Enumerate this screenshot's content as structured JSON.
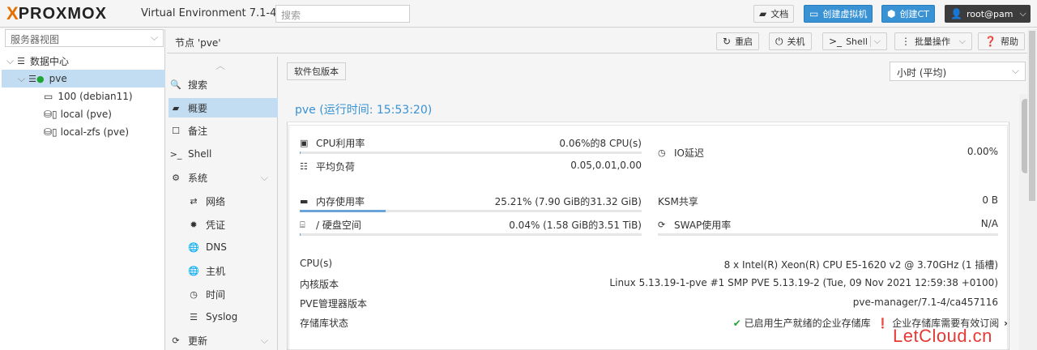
{
  "app": {
    "logo_x": "X",
    "logo_word": "PROXMOX",
    "version": "Virtual Environment 7.1-4",
    "search_placeholder": "搜索"
  },
  "topbar": {
    "docs": "文档",
    "create_vm": "创建虚拟机",
    "create_ct": "创建CT",
    "user": "root@pam"
  },
  "tree": {
    "view": "服务器视图",
    "items": [
      {
        "label": "数据中心"
      },
      {
        "label": "pve"
      },
      {
        "label": "100 (debian11)"
      },
      {
        "label": "local (pve)"
      },
      {
        "label": "local-zfs (pve)"
      }
    ]
  },
  "node": {
    "title": "节点 'pve'",
    "buttons": {
      "restart": "重启",
      "shutdown": "关机",
      "shell": "Shell",
      "bulk": "批量操作",
      "help": "帮助"
    }
  },
  "nav": {
    "items": [
      {
        "label": "搜索"
      },
      {
        "label": "概要"
      },
      {
        "label": "备注"
      },
      {
        "label": "Shell"
      },
      {
        "label": "系统"
      },
      {
        "label": "网络"
      },
      {
        "label": "凭证"
      },
      {
        "label": "DNS"
      },
      {
        "label": "主机"
      },
      {
        "label": "时间"
      },
      {
        "label": "Syslog"
      },
      {
        "label": "更新"
      }
    ]
  },
  "content": {
    "package_versions": "软件包版本",
    "timeframe": "小时 (平均)",
    "summary_title": "pve (运行时间: 15:53:20)",
    "metrics": {
      "cpu_label": "CPU利用率",
      "cpu_value": "0.06%的8 CPU(s)",
      "cpu_pct": 0.06,
      "load_label": "平均负荷",
      "load_value": "0.05,0.01,0.00",
      "io_label": "IO延迟",
      "io_value": "0.00%",
      "mem_label": "内存使用率",
      "mem_value": "25.21% (7.90 GiB的31.32 GiB)",
      "mem_pct": 25.21,
      "ksm_label": "KSM共享",
      "ksm_value": "0 B",
      "disk_label": "/ 硬盘空间",
      "disk_value": "0.04% (1.58 GiB的3.51 TiB)",
      "disk_pct": 0.04,
      "swap_label": "SWAP使用率",
      "swap_value": "N/A"
    },
    "info": {
      "cpus_label": "CPU(s)",
      "cpus_value": "8 x Intel(R) Xeon(R) CPU E5-1620 v2 @ 3.70GHz (1 插槽)",
      "kernel_label": "内核版本",
      "kernel_value": "Linux 5.13.19-1-pve #1 SMP PVE 5.13.19-2 (Tue, 09 Nov 2021 12:59:38 +0100)",
      "pve_label": "PVE管理器版本",
      "pve_value": "pve-manager/7.1-4/ca457116",
      "repo_label": "存储库状态",
      "repo_ok": "已启用生产就绪的企业存储库",
      "repo_warn": "企业存储库需要有效订阅"
    }
  },
  "watermark": "LetCloud.cn",
  "colors": {
    "accent": "#3892d4",
    "selected": "#c2ddf2",
    "brand_orange": "#e57000"
  }
}
